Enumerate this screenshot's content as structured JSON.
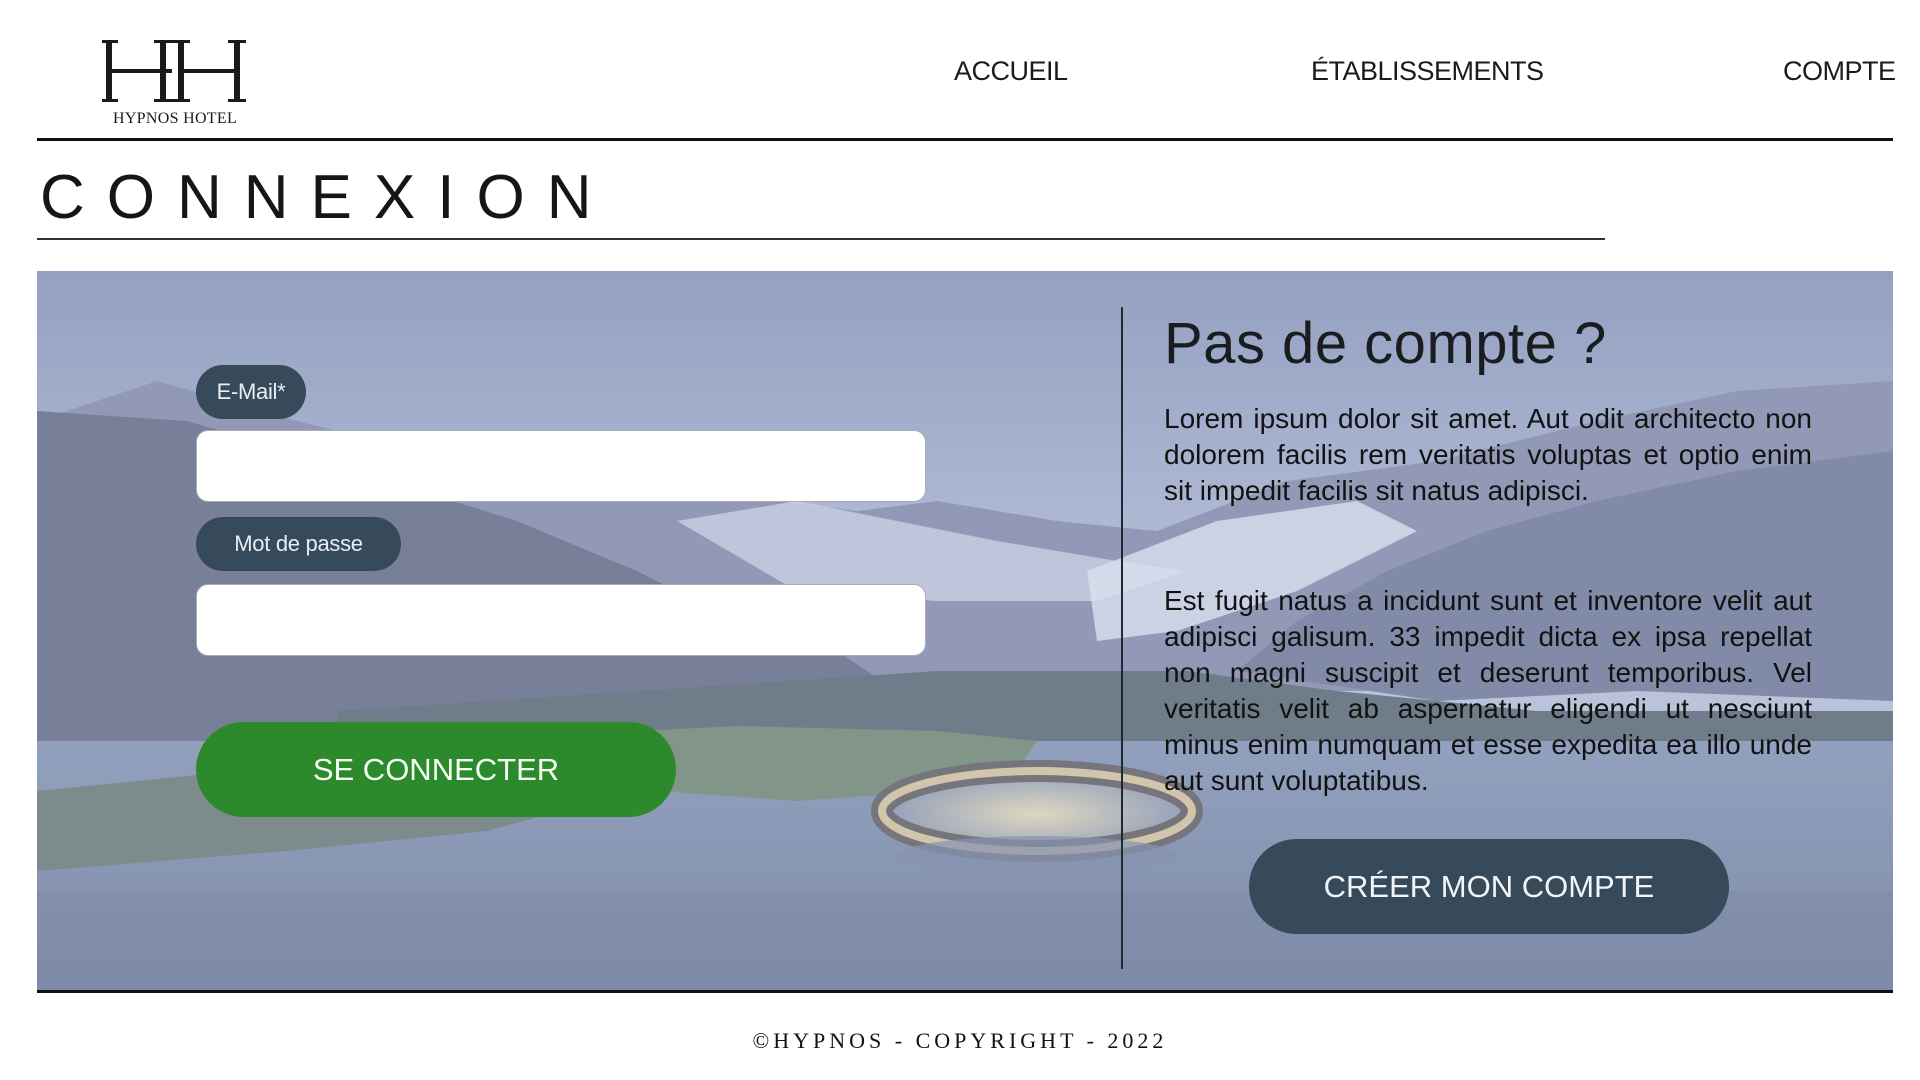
{
  "brand": {
    "logo_monogram": "HH",
    "logo_text": "HYPNOS HOTEL"
  },
  "nav": {
    "items": [
      {
        "label": "ACCUEIL"
      },
      {
        "label": "ÉTABLISSEMENTS"
      },
      {
        "label": "COMPTE"
      }
    ]
  },
  "page": {
    "title": "CONNEXION"
  },
  "login_form": {
    "email_label": "E-Mail*",
    "email_value": "",
    "password_label": "Mot de passe",
    "password_value": "",
    "submit_label": "SE CONNECTER"
  },
  "signup": {
    "title": "Pas de compte ?",
    "paragraph_1": "Lorem ipsum dolor sit amet. Aut odit architecto non dolorem facilis rem veritatis voluptas et optio enim sit impedit facilis sit natus adipisci.",
    "paragraph_2": "Est fugit natus a incidunt sunt et inventore velit aut adipisci galisum. 33 impedit dicta ex ipsa repellat non magni suscipit et deserunt temporibus. Vel veritatis velit ab aspernatur eligendi ut nesciunt minus enim numquam et esse expedita ea illo unde aut sunt voluptatibus.",
    "button_label": "CRÉER MON COMPTE"
  },
  "footer": {
    "text": "©HYPNOS - COPYRIGHT - 2022"
  },
  "colors": {
    "login_button": "#2c8a2c",
    "secondary_button": "#364a5a",
    "label_pill": "#364a5a",
    "rule": "#111111"
  },
  "icons": {
    "hero_image": "mountain-fjord-hotel-image"
  }
}
